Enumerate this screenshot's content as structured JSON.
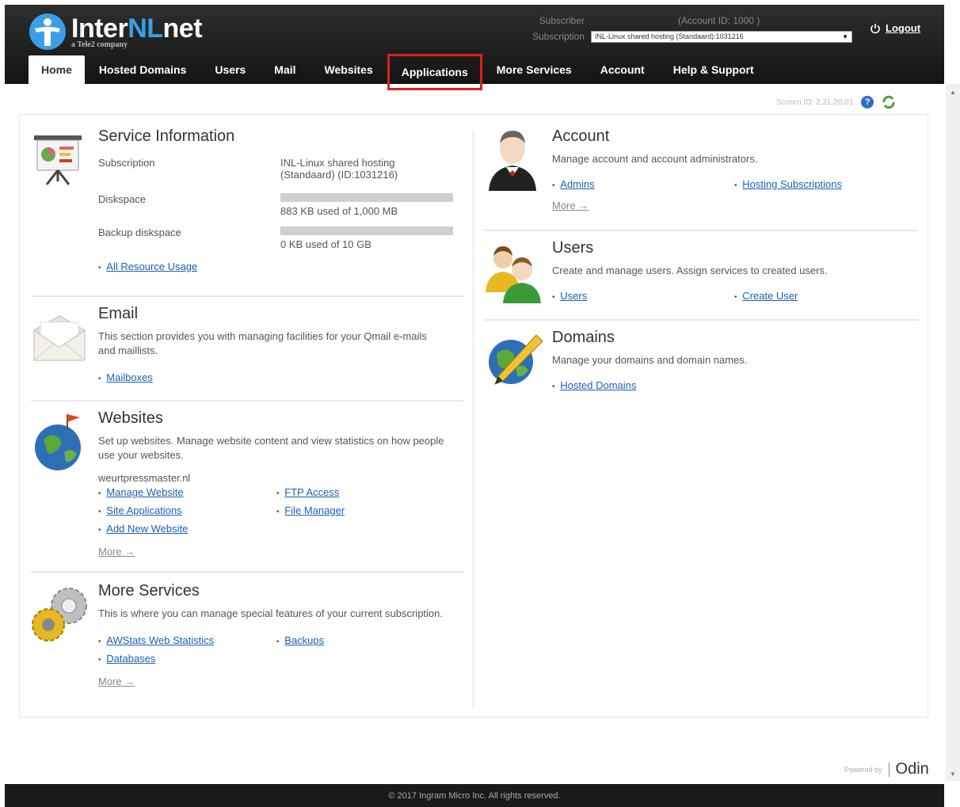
{
  "header": {
    "brand_a": "Inter",
    "brand_b": "NL",
    "brand_c": "net",
    "brand_sub": "a Tele2 company",
    "subscriber_label": "Subscriber",
    "account_id": "(Account ID: 1000     )",
    "subscription_label": "Subscription",
    "subscription_value": "INL-Linux shared hosting (Standaard):1031216",
    "logout": "Logout"
  },
  "nav": {
    "home": "Home",
    "hosted_domains": "Hosted Domains",
    "users": "Users",
    "mail": "Mail",
    "websites": "Websites",
    "applications": "Applications",
    "more_services": "More Services",
    "account": "Account",
    "help": "Help & Support"
  },
  "screen_id": "Screen ID: 2.21.20.01",
  "service": {
    "title": "Service Information",
    "subscription_label": "Subscription",
    "subscription_value_1": "INL-Linux shared hosting",
    "subscription_value_2": "(Standaard) (ID:1031216)",
    "diskspace_label": "Diskspace",
    "diskspace_value": "883 KB used of 1,000 MB",
    "diskspace_fraction": 0.001,
    "backup_label": "Backup diskspace",
    "backup_value": "0 KB used of 10 GB",
    "backup_fraction": 0.0,
    "all_usage": "All Resource Usage"
  },
  "email": {
    "title": "Email",
    "desc": "This section provides you with managing facilities for your Qmail e-mails and maillists.",
    "mailboxes": "Mailboxes"
  },
  "websites": {
    "title": "Websites",
    "desc": "Set up websites. Manage website content and view statistics on how people use your websites.",
    "domain": "weurtpressmaster.nl",
    "manage": "Manage Website",
    "site_apps": "Site Applications",
    "add_new": "Add New Website",
    "ftp": "FTP Access",
    "file_manager": "File Manager",
    "more": "More →"
  },
  "more_services": {
    "title": "More Services",
    "desc": "This is where you can manage special features of your current subscription.",
    "awstats": "AWStats Web Statistics",
    "databases": "Databases",
    "backups": "Backups",
    "more": "More →"
  },
  "account": {
    "title": "Account",
    "desc": "Manage account and account administrators.",
    "admins": "Admins",
    "hosting_subs": "Hosting Subscriptions",
    "more": "More →"
  },
  "users": {
    "title": "Users",
    "desc": "Create and manage users. Assign services to created users.",
    "users_link": "Users",
    "create_user": "Create User"
  },
  "domains": {
    "title": "Domains",
    "desc": "Manage your domains and domain names.",
    "hosted_domains": "Hosted Domains"
  },
  "powered_by": "Powered by",
  "odin": "Odin",
  "footer": "© 2017 Ingram Micro Inc. All rights reserved."
}
